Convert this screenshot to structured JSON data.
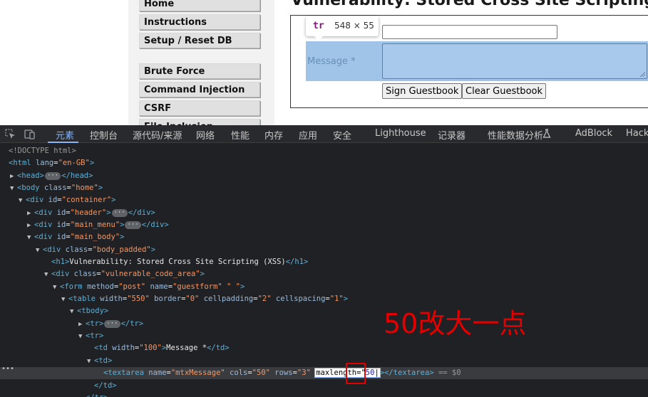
{
  "page": {
    "menu": [
      "Home",
      "Instructions",
      "Setup / Reset DB",
      "Brute Force",
      "Command Injection",
      "CSRF",
      "File Inclusion"
    ],
    "heading": "Vulnerability: Stored Cross Site Scripting (XSS)",
    "message_label": "Message *",
    "sign_button": "Sign Guestbook",
    "clear_button": "Clear Guestbook",
    "tooltip": {
      "tag": "tr",
      "size": "548 × 55"
    },
    "highlight_color": "#9fc4e8"
  },
  "devtools": {
    "tabs": [
      "元素",
      "控制台",
      "源代码/来源",
      "网络",
      "性能",
      "内存",
      "应用",
      "安全",
      "Lighthouse",
      "记录器",
      "性能数据分析",
      "AdBlock",
      "HackBar"
    ],
    "active_tab": "元素",
    "accent": "#8ab4f8",
    "tree": {
      "doctype": "<!DOCTYPE html>",
      "html_lang": "\"en-GB\"",
      "body_class": "\"home\"",
      "container_id": "\"container\"",
      "header_id": "\"header\"",
      "main_menu_id": "\"main_menu\"",
      "main_body_id": "\"main_body\"",
      "body_padded_class": "\"body_padded\"",
      "h1_text": "Vulnerability: Stored Cross Site Scripting (XSS)",
      "vuln_class": "\"vulnerable_code_area\"",
      "form_method": "\"post\"",
      "form_name": "\"guestform\"",
      "form_extra": "\" \"",
      "table_width": "\"550\"",
      "table_border": "\"0\"",
      "table_cellpadding": "\"2\"",
      "table_cellspacing": "\"1\"",
      "td_width": "\"100\"",
      "td_text": "Message *",
      "textarea_name": "\"mtxMessage\"",
      "textarea_cols": "\"50\"",
      "textarea_rows": "\"3\"",
      "maxlength_attr": "maxlength",
      "maxlength_value": "50",
      "eq_dollar": "== $0"
    }
  },
  "annotation": {
    "text": "50改大一点",
    "color": "#e30000"
  }
}
